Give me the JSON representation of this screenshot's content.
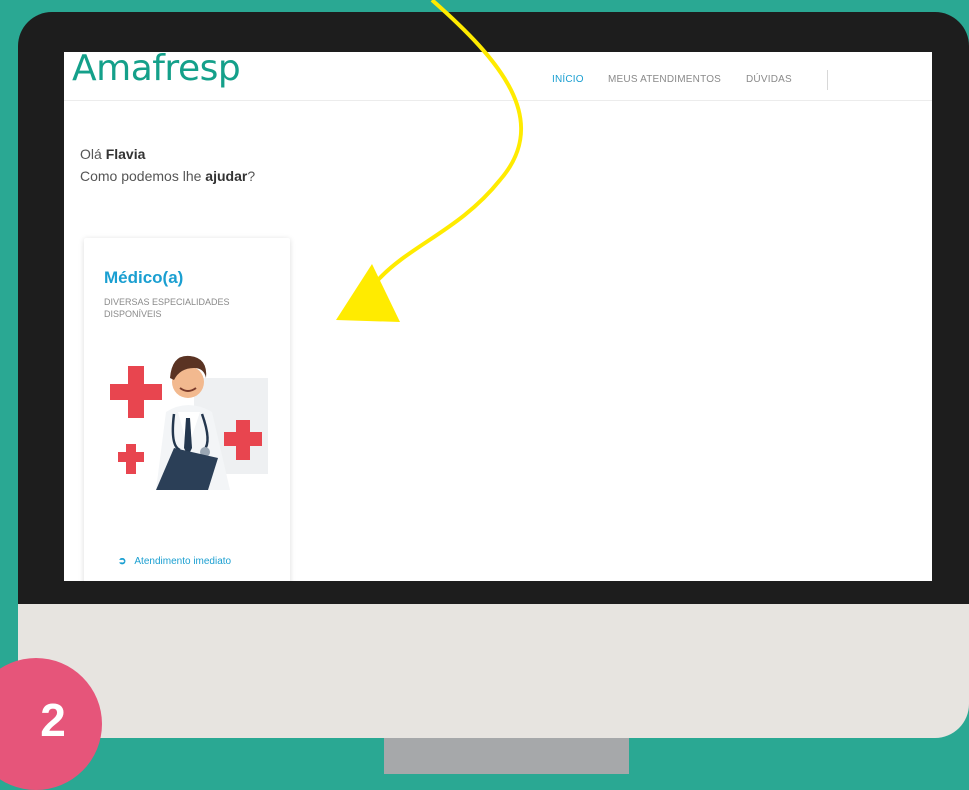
{
  "logo": {
    "text": "Amafresp"
  },
  "nav": {
    "items": [
      {
        "label": "INÍCIO",
        "active": true
      },
      {
        "label": "MEUS ATENDIMENTOS",
        "active": false
      },
      {
        "label": "DÚVIDAS",
        "active": false
      }
    ]
  },
  "greeting": {
    "hello": "Olá",
    "name": "Flavia",
    "question_before": "Como podemos lhe",
    "question_bold": "ajudar",
    "question_after": "?"
  },
  "card": {
    "title": "Médico(a)",
    "subtitle": "DIVERSAS ESPECIALIDADES DISPONÍVEIS",
    "action_label": "Atendimento imediato",
    "illustration": "doctor-illustration"
  },
  "step": {
    "number": "2"
  },
  "colors": {
    "background": "#2aa893",
    "brand": "#14a08a",
    "accent": "#1a9fd1",
    "badge": "#e6557a",
    "arrow": "#ffeb00",
    "bezel": "#1d1d1d",
    "chin": "#e7e4e0",
    "stand": "#a6a8aa"
  }
}
